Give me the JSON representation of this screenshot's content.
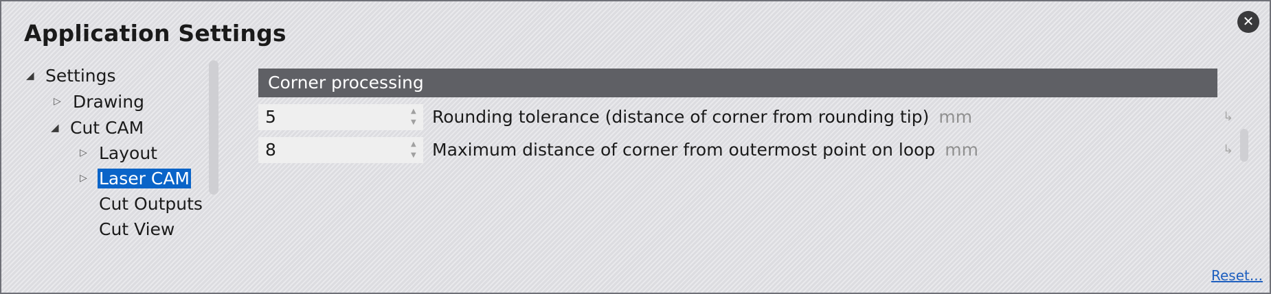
{
  "window": {
    "title": "Application Settings"
  },
  "close_icon": "close-icon",
  "tree": [
    {
      "label": "Settings",
      "state": "expanded"
    },
    {
      "label": "Drawing",
      "state": "collapsed"
    },
    {
      "label": "Cut CAM",
      "state": "expanded"
    },
    {
      "label": "Layout",
      "state": "collapsed"
    },
    {
      "label": "Laser CAM",
      "state": "collapsed",
      "selected": true
    },
    {
      "label": "Cut Outputs",
      "state": "leaf"
    },
    {
      "label": "Cut View",
      "state": "leaf"
    }
  ],
  "section": {
    "title": "Corner processing"
  },
  "settings": [
    {
      "value": "5",
      "label": "Rounding tolerance (distance of corner from rounding tip)",
      "unit": "mm"
    },
    {
      "value": "8",
      "label": "Maximum distance of corner from outermost point on loop",
      "unit": "mm"
    }
  ],
  "footer": {
    "reset_label": "Reset..."
  },
  "colors": {
    "selection": "#0a64c8",
    "section_header": "#5f6065",
    "link": "#1e5fbf"
  }
}
